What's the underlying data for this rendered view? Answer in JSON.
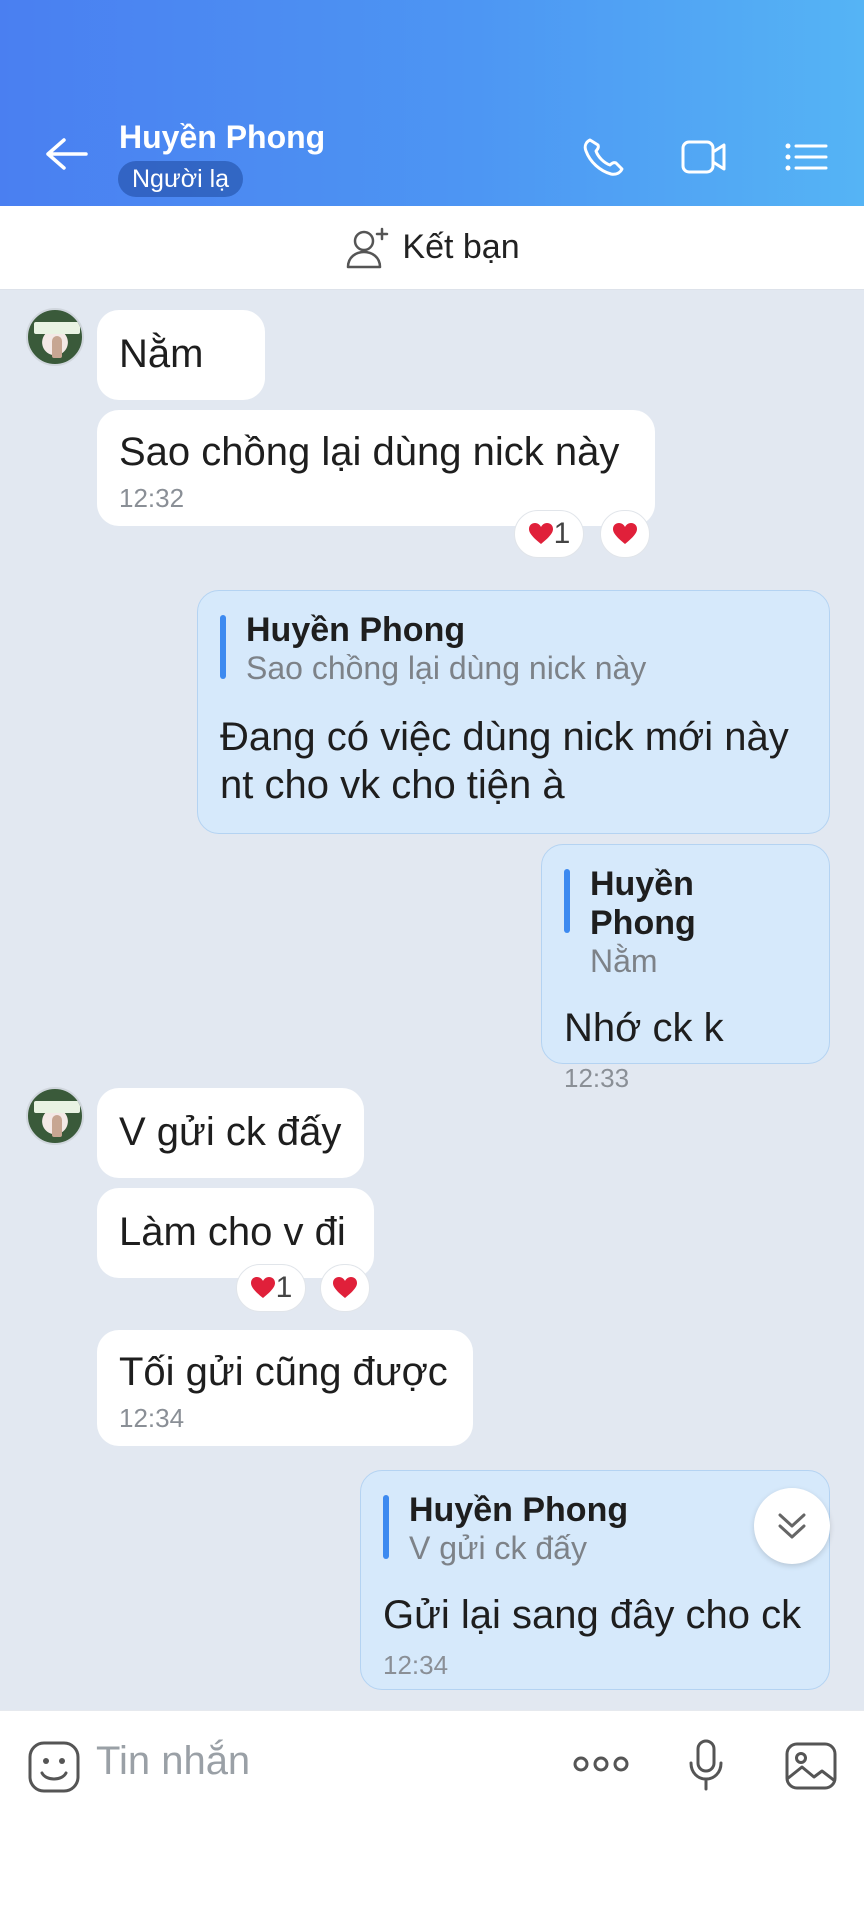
{
  "header": {
    "contact_name": "Huyền Phong",
    "status_badge": "Người lạ",
    "icons": [
      "back-arrow-icon",
      "phone-icon",
      "video-call-icon",
      "menu-list-icon"
    ],
    "colors": {
      "gradient_start": "#4a7ff1",
      "gradient_end": "#55b4f5"
    }
  },
  "friend_bar": {
    "label": "Kết bạn",
    "icon": "add-friend-icon"
  },
  "messages": [
    {
      "sender": "them",
      "text": "Nằm"
    },
    {
      "sender": "them",
      "text": "Sao chồng lại dùng nick này",
      "time": "12:32",
      "reactions": {
        "count": "1"
      }
    },
    {
      "sender": "me",
      "quote_name": "Huyền Phong",
      "quote_text": "Sao chồng lại dùng nick này",
      "text_line1": "Đang có việc dùng nick mới này",
      "text_line2": "nt cho vk cho tiện à"
    },
    {
      "sender": "me",
      "quote_name": "Huyền Phong",
      "quote_text": "Nằm",
      "text": "Nhớ ck k",
      "time": "12:33"
    },
    {
      "sender": "them",
      "text": "V gửi ck đấy"
    },
    {
      "sender": "them",
      "text": "Làm cho v đi",
      "reactions": {
        "count": "1"
      }
    },
    {
      "sender": "them",
      "text": "Tối gửi cũng được",
      "time": "12:34"
    },
    {
      "sender": "me",
      "quote_name": "Huyền Phong",
      "quote_text": "V gửi ck đấy",
      "text": "Gửi lại sang đây cho ck",
      "time": "12:34"
    }
  ],
  "input": {
    "placeholder": "Tin nhắn",
    "icons": [
      "emoji-icon",
      "more-icon",
      "microphone-icon",
      "image-icon"
    ]
  }
}
